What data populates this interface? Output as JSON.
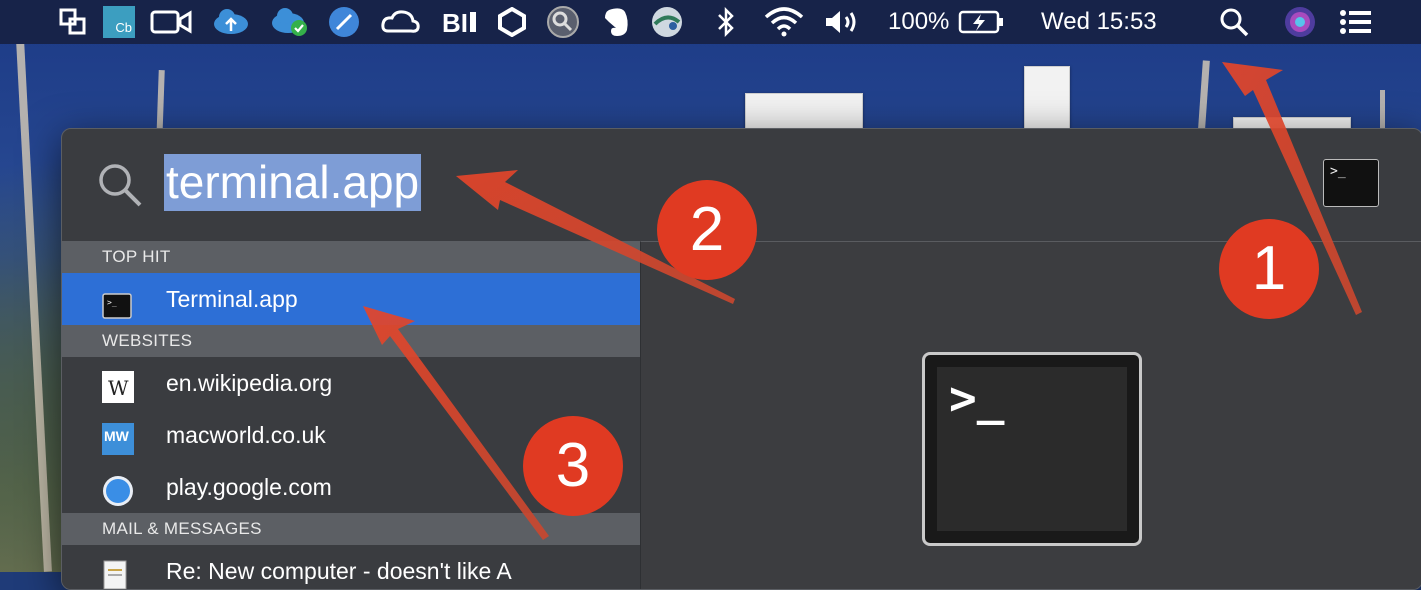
{
  "menubar": {
    "battery_percent": "100%",
    "clock": "Wed 15:53",
    "icons": [
      "window-icon",
      "cb-icon",
      "video-icon",
      "cloud-upload-icon",
      "cloud-check-icon",
      "feather-icon",
      "creative-cloud-icon",
      "bi-icon",
      "hexagon-icon",
      "magnifier-app-icon",
      "evernote-icon",
      "network-icon",
      "bluetooth-icon",
      "wifi-icon",
      "volume-icon",
      "battery-icon",
      "spotlight-icon",
      "siri-icon",
      "notification-center-icon"
    ]
  },
  "spotlight": {
    "query": "terminal.app",
    "sections": [
      {
        "header": "TOP HIT",
        "items": [
          {
            "label": "Terminal.app",
            "icon": "terminal-icon",
            "selected": true
          }
        ]
      },
      {
        "header": "WEBSITES",
        "items": [
          {
            "label": "en.wikipedia.org",
            "icon": "wikipedia-icon"
          },
          {
            "label": "macworld.co.uk",
            "icon": "macworld-icon"
          },
          {
            "label": "play.google.com",
            "icon": "safari-icon"
          }
        ]
      },
      {
        "header": "MAIL & MESSAGES",
        "items": [
          {
            "label": "Re: New computer - doesn't like A",
            "icon": "document-icon"
          }
        ]
      }
    ],
    "preview_prompt": ">_"
  },
  "callouts": [
    "1",
    "2",
    "3"
  ],
  "colors": {
    "menubar": "#172349",
    "selection": "#2d6fd6",
    "callout": "#e03a22",
    "query_highlight": "#7e9dd6"
  }
}
